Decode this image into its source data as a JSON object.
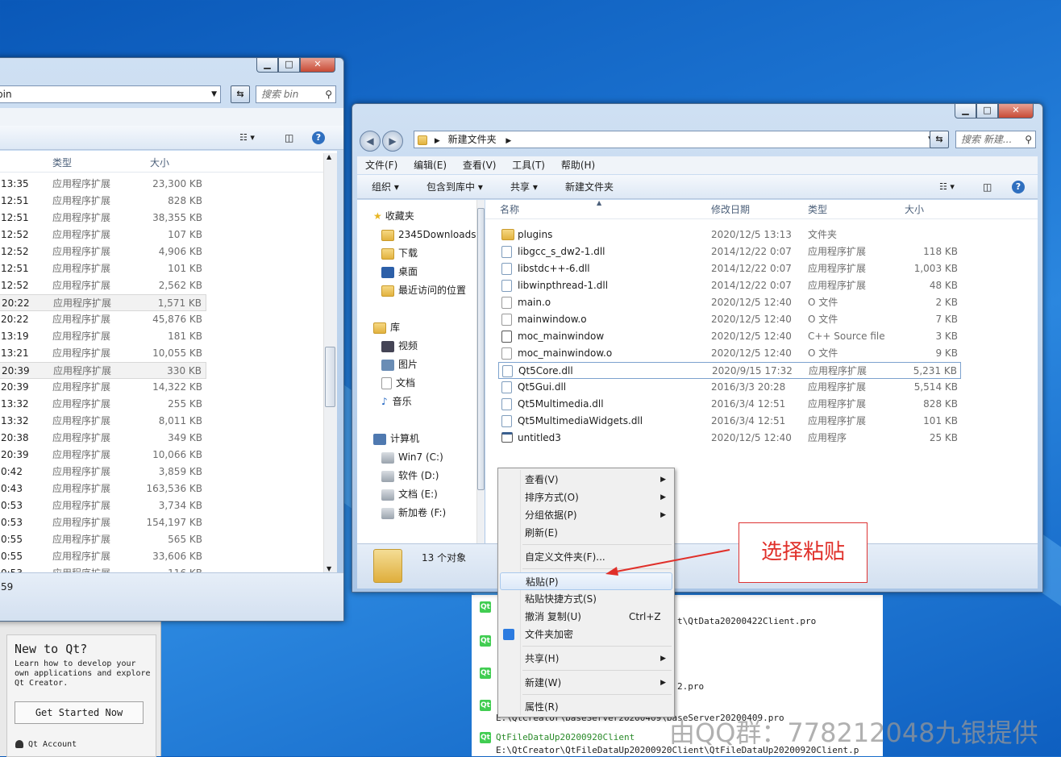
{
  "qt_creator": {
    "title": "New to Qt?",
    "description": "Learn how to develop your own applications and explore Qt Creator.",
    "get_started": "Get Started Now",
    "account": "Qt Account",
    "projects": [
      {
        "name": "",
        "path": "t\\QtData20200422Client.pro"
      },
      {
        "name": "",
        "path": ""
      },
      {
        "name": "",
        "path": "2.pro"
      },
      {
        "name": "",
        "path": "E:\\QtCreator\\baseServer20200409\\baseServer20200409.pro"
      },
      {
        "name": "QtFileDataUp20200920Client",
        "path": "E:\\QtCreator\\QtFileDataUp20200920Client\\QtFileDataUp20200920Client.p"
      }
    ]
  },
  "left_window": {
    "address": "bin",
    "search_placeholder": "搜索 bin",
    "col_type": "类型",
    "col_size": "大小",
    "rows": [
      {
        "time": "13:35",
        "type": "应用程序扩展",
        "size": "23,300 KB"
      },
      {
        "time": "12:51",
        "type": "应用程序扩展",
        "size": "828 KB"
      },
      {
        "time": "12:51",
        "type": "应用程序扩展",
        "size": "38,355 KB"
      },
      {
        "time": "12:52",
        "type": "应用程序扩展",
        "size": "107 KB"
      },
      {
        "time": "12:52",
        "type": "应用程序扩展",
        "size": "4,906 KB"
      },
      {
        "time": "12:51",
        "type": "应用程序扩展",
        "size": "101 KB"
      },
      {
        "time": "12:52",
        "type": "应用程序扩展",
        "size": "2,562 KB"
      },
      {
        "time": "20:22",
        "type": "应用程序扩展",
        "size": "1,571 KB"
      },
      {
        "time": "20:22",
        "type": "应用程序扩展",
        "size": "45,876 KB"
      },
      {
        "time": "13:19",
        "type": "应用程序扩展",
        "size": "181 KB"
      },
      {
        "time": "13:21",
        "type": "应用程序扩展",
        "size": "10,055 KB"
      },
      {
        "time": "20:39",
        "type": "应用程序扩展",
        "size": "330 KB"
      },
      {
        "time": "20:39",
        "type": "应用程序扩展",
        "size": "14,322 KB"
      },
      {
        "time": "13:32",
        "type": "应用程序扩展",
        "size": "255 KB"
      },
      {
        "time": "13:32",
        "type": "应用程序扩展",
        "size": "8,011 KB"
      },
      {
        "time": "20:38",
        "type": "应用程序扩展",
        "size": "349 KB"
      },
      {
        "time": "20:39",
        "type": "应用程序扩展",
        "size": "10,066 KB"
      },
      {
        "time": "0:42",
        "type": "应用程序扩展",
        "size": "3,859 KB"
      },
      {
        "time": "0:43",
        "type": "应用程序扩展",
        "size": "163,536 KB"
      },
      {
        "time": "0:53",
        "type": "应用程序扩展",
        "size": "3,734 KB"
      },
      {
        "time": "0:53",
        "type": "应用程序扩展",
        "size": "154,197 KB"
      },
      {
        "time": "0:55",
        "type": "应用程序扩展",
        "size": "565 KB"
      },
      {
        "time": "0:55",
        "type": "应用程序扩展",
        "size": "33,606 KB"
      },
      {
        "time": "0:53",
        "type": "应用程序扩展",
        "size": "116 KB"
      }
    ],
    "status": "59"
  },
  "right_window": {
    "breadcrumb": "新建文件夹",
    "search_placeholder": "搜索 新建...",
    "menu": [
      "文件(F)",
      "编辑(E)",
      "查看(V)",
      "工具(T)",
      "帮助(H)"
    ],
    "toolbar": {
      "organize": "组织",
      "include": "包含到库中",
      "share": "共享",
      "new_folder": "新建文件夹"
    },
    "nav": {
      "favorites": "收藏夹",
      "fav_items": [
        "2345Downloads",
        "下载",
        "桌面",
        "最近访问的位置"
      ],
      "libraries": "库",
      "lib_items": [
        "视频",
        "图片",
        "文档",
        "音乐"
      ],
      "computer": "计算机",
      "drives": [
        "Win7 (C:)",
        "软件 (D:)",
        "文档 (E:)",
        "新加卷 (F:)"
      ]
    },
    "columns": {
      "name": "名称",
      "date": "修改日期",
      "type": "类型",
      "size": "大小"
    },
    "files": [
      {
        "name": "plugins",
        "date": "2020/12/5 13:13",
        "type": "文件夹",
        "size": "",
        "icon": "folder-icon"
      },
      {
        "name": "libgcc_s_dw2-1.dll",
        "date": "2014/12/22 0:07",
        "type": "应用程序扩展",
        "size": "118 KB",
        "icon": "dll-icon"
      },
      {
        "name": "libstdc++-6.dll",
        "date": "2014/12/22 0:07",
        "type": "应用程序扩展",
        "size": "1,003 KB",
        "icon": "dll-icon"
      },
      {
        "name": "libwinpthread-1.dll",
        "date": "2014/12/22 0:07",
        "type": "应用程序扩展",
        "size": "48 KB",
        "icon": "dll-icon"
      },
      {
        "name": "main.o",
        "date": "2020/12/5 12:40",
        "type": "O 文件",
        "size": "2 KB",
        "icon": "file-icon"
      },
      {
        "name": "mainwindow.o",
        "date": "2020/12/5 12:40",
        "type": "O 文件",
        "size": "7 KB",
        "icon": "file-icon"
      },
      {
        "name": "moc_mainwindow",
        "date": "2020/12/5 12:40",
        "type": "C++ Source file",
        "size": "3 KB",
        "icon": "cpp-icon"
      },
      {
        "name": "moc_mainwindow.o",
        "date": "2020/12/5 12:40",
        "type": "O 文件",
        "size": "9 KB",
        "icon": "file-icon"
      },
      {
        "name": "Qt5Core.dll",
        "date": "2020/9/15 17:32",
        "type": "应用程序扩展",
        "size": "5,231 KB",
        "icon": "dll-icon"
      },
      {
        "name": "Qt5Gui.dll",
        "date": "2016/3/3 20:28",
        "type": "应用程序扩展",
        "size": "5,514 KB",
        "icon": "dll-icon"
      },
      {
        "name": "Qt5Multimedia.dll",
        "date": "2016/3/4 12:51",
        "type": "应用程序扩展",
        "size": "828 KB",
        "icon": "dll-icon"
      },
      {
        "name": "Qt5MultimediaWidgets.dll",
        "date": "2016/3/4 12:51",
        "type": "应用程序扩展",
        "size": "101 KB",
        "icon": "dll-icon"
      },
      {
        "name": "untitled3",
        "date": "2020/12/5 12:40",
        "type": "应用程序",
        "size": "25 KB",
        "icon": "exe-icon"
      }
    ],
    "status": "13 个对象"
  },
  "context_menu": {
    "view": "查看(V)",
    "sort": "排序方式(O)",
    "group": "分组依据(P)",
    "refresh": "刷新(E)",
    "customize": "自定义文件夹(F)...",
    "paste": "粘贴(P)",
    "paste_shortcut": "粘贴快捷方式(S)",
    "undo": "撤消 复制(U)",
    "undo_key": "Ctrl+Z",
    "encrypt": "文件夹加密",
    "share": "共享(H)",
    "new": "新建(W)",
    "properties": "属性(R)"
  },
  "annotation": "选择粘贴",
  "watermark": "由QQ群：778212048九银提供"
}
